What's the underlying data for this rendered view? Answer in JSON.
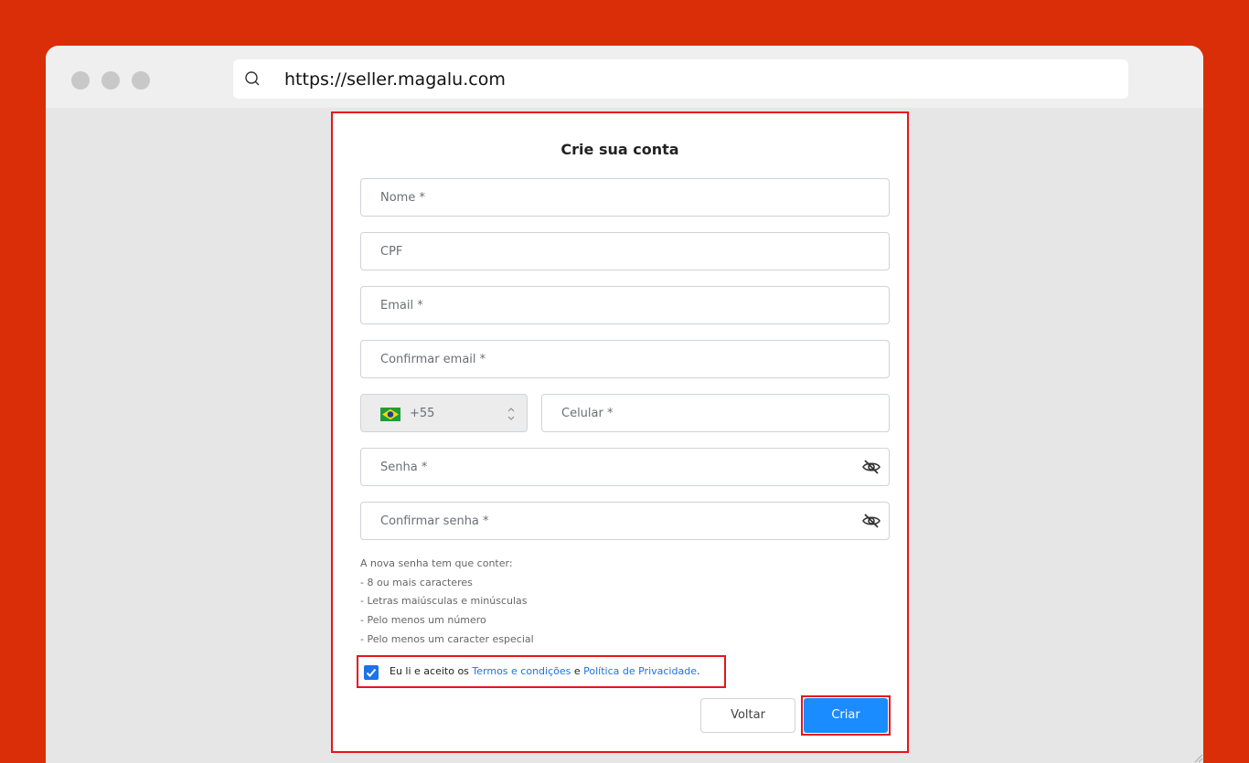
{
  "browser": {
    "url": "https://seller.magalu.com"
  },
  "form": {
    "title": "Crie sua conta",
    "fields": {
      "nome": "Nome *",
      "cpf": "CPF",
      "email": "Email *",
      "confirmar_email": "Confirmar email *",
      "country_code": "+55",
      "celular": "Celular *",
      "senha": "Senha *",
      "confirmar_senha": "Confirmar senha *"
    },
    "password_rules": [
      "A nova senha tem que conter:",
      "- 8 ou mais caracteres",
      "- Letras maiúsculas e minúsculas",
      "- Pelo menos um número",
      "- Pelo menos um caracter especial"
    ],
    "terms": {
      "checked": true,
      "prefix": "Eu li e aceito os ",
      "terms_link": "Termos e condições",
      "middle": " e ",
      "privacy_link": "Política de Privacidade",
      "suffix": "."
    },
    "buttons": {
      "back": "Voltar",
      "create": "Criar"
    }
  },
  "colors": {
    "background": "#d92e07",
    "highlight": "#e8141c",
    "primary": "#1a8cff",
    "link": "#1a73e8"
  },
  "icons": {
    "country_flag": "brazil-flag-icon",
    "password_toggle": "eye-slash-icon",
    "url_search": "search-icon"
  }
}
